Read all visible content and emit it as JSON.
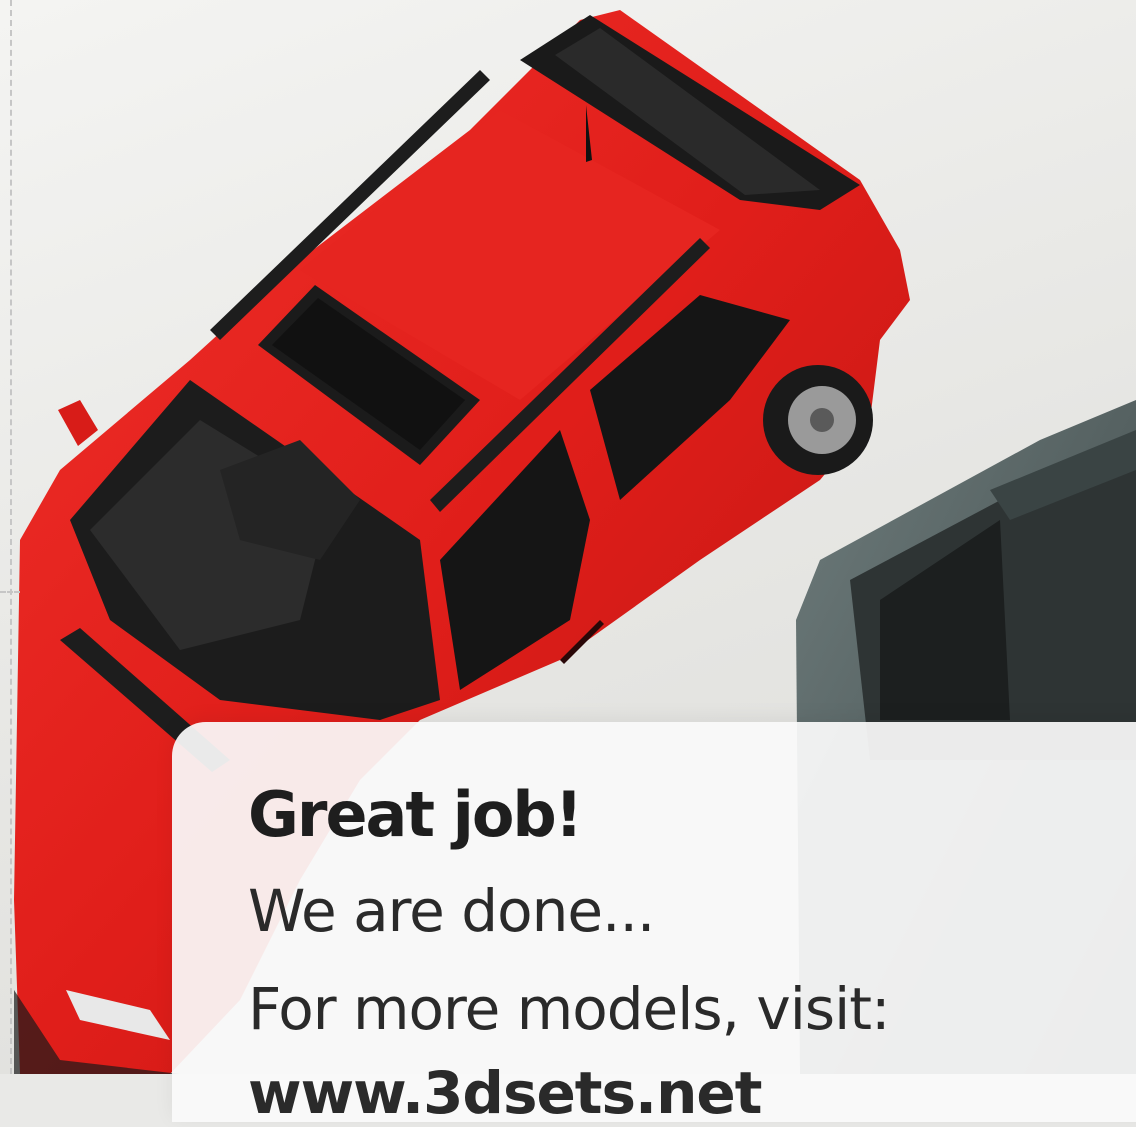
{
  "card": {
    "title": "Great job!",
    "subtitle": "We are done...",
    "visit_text": "For more models, visit:",
    "link_text": "www.3dsets.net"
  },
  "colors": {
    "card_background": "#fafafa",
    "title_text": "#1e1e1e",
    "body_text": "#2a2a2a",
    "red_car_body": "#e0201c",
    "second_car_body": "#4a5a5a",
    "backdrop": "#ececea"
  }
}
